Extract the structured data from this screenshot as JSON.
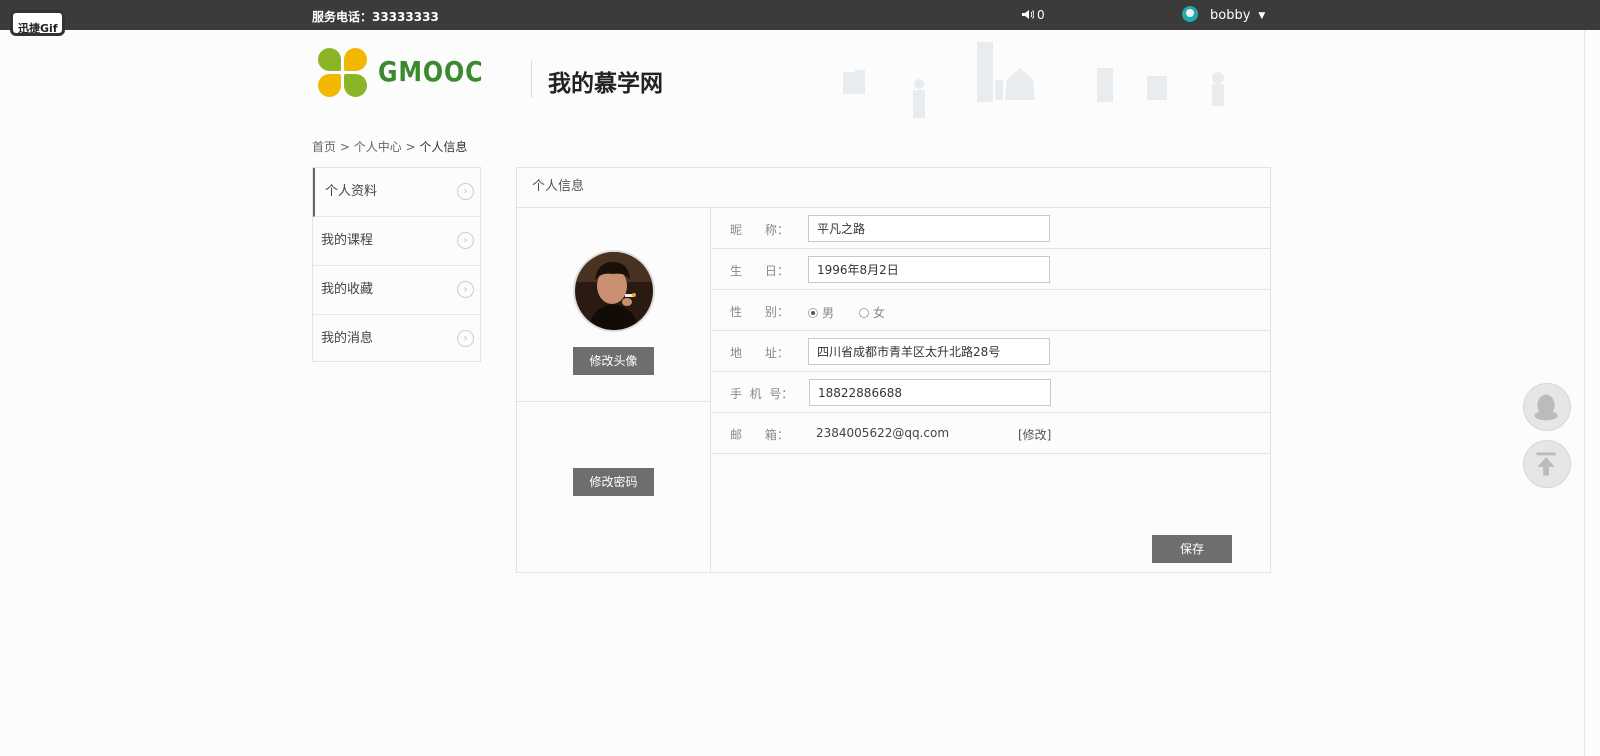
{
  "overlay": {
    "badge": "迅捷Gif"
  },
  "topbar": {
    "phone": "服务电话：33333333",
    "message_count": "0",
    "username": "bobby",
    "caret": "▼",
    "icons": {
      "speaker": "speaker-icon",
      "avatar": "user-avatar-icon"
    }
  },
  "header": {
    "brand": "GMOOC",
    "site_title": "我的慕学网",
    "colors": {
      "brand_green": "#3c8a2e",
      "logo_yellow": "#f2b700",
      "logo_green": "#8bb527"
    }
  },
  "breadcrumb": {
    "home": "首页",
    "sep": " > ",
    "center": "个人中心",
    "current": "个人信息"
  },
  "sidebar": {
    "items": [
      {
        "label": "个人资料",
        "active": true
      },
      {
        "label": "我的课程",
        "active": false
      },
      {
        "label": "我的收藏",
        "active": false
      },
      {
        "label": "我的消息",
        "active": false
      }
    ],
    "arrow_glyph": "›"
  },
  "panel": {
    "title": "个人信息",
    "change_avatar": "修改头像",
    "change_password": "修改密码",
    "fields": {
      "nickname_label": "昵      称：",
      "nickname_value": "平凡之路",
      "birthday_label": "生      日：",
      "birthday_value": "1996年8月2日",
      "gender_label": "性      别：",
      "gender_male": "男",
      "gender_female": "女",
      "gender_selected": "男",
      "address_label": "地      址：",
      "address_value": "四川省成都市青羊区太升北路28号",
      "mobile_label": "手  机  号：",
      "mobile_value": "18822886688",
      "email_label": "邮      箱：",
      "email_value": "2384005622@qq.com",
      "email_edit": "[修改]"
    },
    "save": "保存",
    "colors": {
      "button_grey": "#6e6e6e",
      "topbar": "#3b3b3b"
    }
  },
  "floating": {
    "qq": "qq-icon",
    "back_to_top": "back-to-top-icon"
  }
}
